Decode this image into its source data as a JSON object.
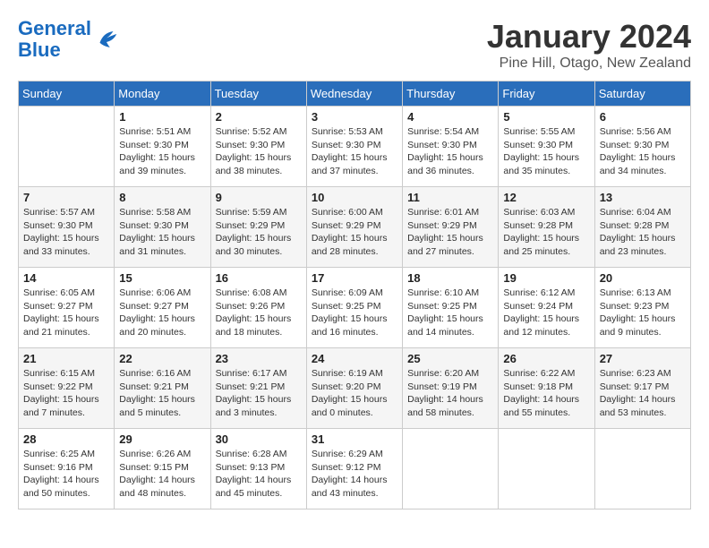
{
  "header": {
    "logo_line1": "General",
    "logo_line2": "Blue",
    "month": "January 2024",
    "location": "Pine Hill, Otago, New Zealand"
  },
  "weekdays": [
    "Sunday",
    "Monday",
    "Tuesday",
    "Wednesday",
    "Thursday",
    "Friday",
    "Saturday"
  ],
  "weeks": [
    [
      {
        "day": "",
        "info": ""
      },
      {
        "day": "1",
        "info": "Sunrise: 5:51 AM\nSunset: 9:30 PM\nDaylight: 15 hours\nand 39 minutes."
      },
      {
        "day": "2",
        "info": "Sunrise: 5:52 AM\nSunset: 9:30 PM\nDaylight: 15 hours\nand 38 minutes."
      },
      {
        "day": "3",
        "info": "Sunrise: 5:53 AM\nSunset: 9:30 PM\nDaylight: 15 hours\nand 37 minutes."
      },
      {
        "day": "4",
        "info": "Sunrise: 5:54 AM\nSunset: 9:30 PM\nDaylight: 15 hours\nand 36 minutes."
      },
      {
        "day": "5",
        "info": "Sunrise: 5:55 AM\nSunset: 9:30 PM\nDaylight: 15 hours\nand 35 minutes."
      },
      {
        "day": "6",
        "info": "Sunrise: 5:56 AM\nSunset: 9:30 PM\nDaylight: 15 hours\nand 34 minutes."
      }
    ],
    [
      {
        "day": "7",
        "info": "Sunrise: 5:57 AM\nSunset: 9:30 PM\nDaylight: 15 hours\nand 33 minutes."
      },
      {
        "day": "8",
        "info": "Sunrise: 5:58 AM\nSunset: 9:30 PM\nDaylight: 15 hours\nand 31 minutes."
      },
      {
        "day": "9",
        "info": "Sunrise: 5:59 AM\nSunset: 9:29 PM\nDaylight: 15 hours\nand 30 minutes."
      },
      {
        "day": "10",
        "info": "Sunrise: 6:00 AM\nSunset: 9:29 PM\nDaylight: 15 hours\nand 28 minutes."
      },
      {
        "day": "11",
        "info": "Sunrise: 6:01 AM\nSunset: 9:29 PM\nDaylight: 15 hours\nand 27 minutes."
      },
      {
        "day": "12",
        "info": "Sunrise: 6:03 AM\nSunset: 9:28 PM\nDaylight: 15 hours\nand 25 minutes."
      },
      {
        "day": "13",
        "info": "Sunrise: 6:04 AM\nSunset: 9:28 PM\nDaylight: 15 hours\nand 23 minutes."
      }
    ],
    [
      {
        "day": "14",
        "info": "Sunrise: 6:05 AM\nSunset: 9:27 PM\nDaylight: 15 hours\nand 21 minutes."
      },
      {
        "day": "15",
        "info": "Sunrise: 6:06 AM\nSunset: 9:27 PM\nDaylight: 15 hours\nand 20 minutes."
      },
      {
        "day": "16",
        "info": "Sunrise: 6:08 AM\nSunset: 9:26 PM\nDaylight: 15 hours\nand 18 minutes."
      },
      {
        "day": "17",
        "info": "Sunrise: 6:09 AM\nSunset: 9:25 PM\nDaylight: 15 hours\nand 16 minutes."
      },
      {
        "day": "18",
        "info": "Sunrise: 6:10 AM\nSunset: 9:25 PM\nDaylight: 15 hours\nand 14 minutes."
      },
      {
        "day": "19",
        "info": "Sunrise: 6:12 AM\nSunset: 9:24 PM\nDaylight: 15 hours\nand 12 minutes."
      },
      {
        "day": "20",
        "info": "Sunrise: 6:13 AM\nSunset: 9:23 PM\nDaylight: 15 hours\nand 9 minutes."
      }
    ],
    [
      {
        "day": "21",
        "info": "Sunrise: 6:15 AM\nSunset: 9:22 PM\nDaylight: 15 hours\nand 7 minutes."
      },
      {
        "day": "22",
        "info": "Sunrise: 6:16 AM\nSunset: 9:21 PM\nDaylight: 15 hours\nand 5 minutes."
      },
      {
        "day": "23",
        "info": "Sunrise: 6:17 AM\nSunset: 9:21 PM\nDaylight: 15 hours\nand 3 minutes."
      },
      {
        "day": "24",
        "info": "Sunrise: 6:19 AM\nSunset: 9:20 PM\nDaylight: 15 hours\nand 0 minutes."
      },
      {
        "day": "25",
        "info": "Sunrise: 6:20 AM\nSunset: 9:19 PM\nDaylight: 14 hours\nand 58 minutes."
      },
      {
        "day": "26",
        "info": "Sunrise: 6:22 AM\nSunset: 9:18 PM\nDaylight: 14 hours\nand 55 minutes."
      },
      {
        "day": "27",
        "info": "Sunrise: 6:23 AM\nSunset: 9:17 PM\nDaylight: 14 hours\nand 53 minutes."
      }
    ],
    [
      {
        "day": "28",
        "info": "Sunrise: 6:25 AM\nSunset: 9:16 PM\nDaylight: 14 hours\nand 50 minutes."
      },
      {
        "day": "29",
        "info": "Sunrise: 6:26 AM\nSunset: 9:15 PM\nDaylight: 14 hours\nand 48 minutes."
      },
      {
        "day": "30",
        "info": "Sunrise: 6:28 AM\nSunset: 9:13 PM\nDaylight: 14 hours\nand 45 minutes."
      },
      {
        "day": "31",
        "info": "Sunrise: 6:29 AM\nSunset: 9:12 PM\nDaylight: 14 hours\nand 43 minutes."
      },
      {
        "day": "",
        "info": ""
      },
      {
        "day": "",
        "info": ""
      },
      {
        "day": "",
        "info": ""
      }
    ]
  ]
}
